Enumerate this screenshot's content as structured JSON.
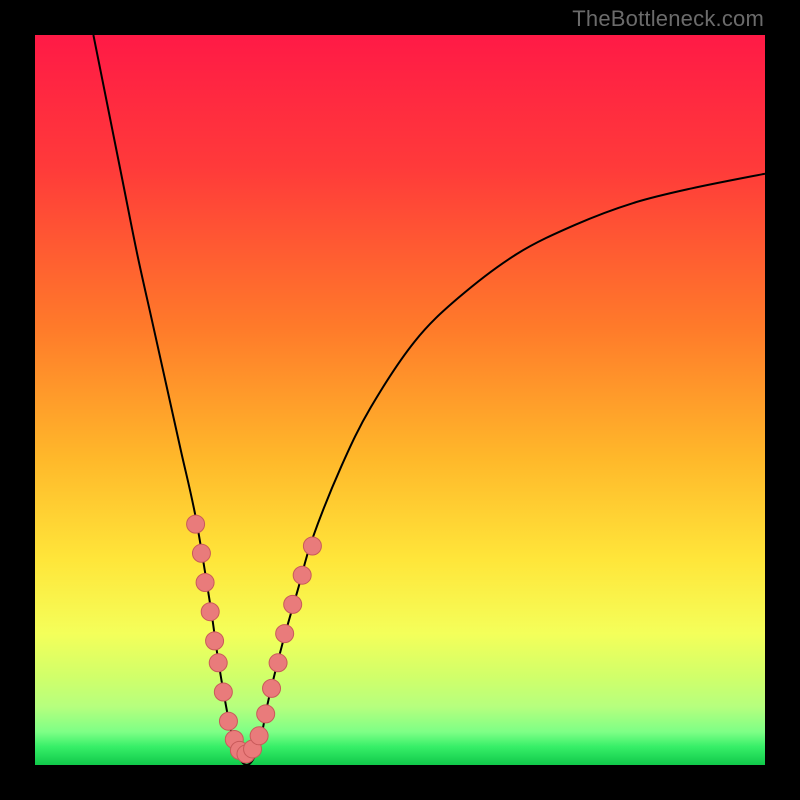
{
  "watermark": "TheBottleneck.com",
  "colors": {
    "black": "#000000",
    "curve": "#000000",
    "marker_fill": "#e97b7b",
    "marker_stroke": "#c95a5a",
    "gradient_stops": [
      {
        "offset": 0.0,
        "color": "#ff1a46"
      },
      {
        "offset": 0.18,
        "color": "#ff3a3a"
      },
      {
        "offset": 0.4,
        "color": "#ff7a2a"
      },
      {
        "offset": 0.58,
        "color": "#ffb82a"
      },
      {
        "offset": 0.72,
        "color": "#ffe63a"
      },
      {
        "offset": 0.82,
        "color": "#f4ff5a"
      },
      {
        "offset": 0.88,
        "color": "#d0ff6a"
      },
      {
        "offset": 0.92,
        "color": "#b6ff7e"
      },
      {
        "offset": 0.955,
        "color": "#7dff86"
      },
      {
        "offset": 0.975,
        "color": "#37ef68"
      },
      {
        "offset": 1.0,
        "color": "#10c94a"
      }
    ]
  },
  "chart_data": {
    "type": "line",
    "title": "",
    "xlabel": "",
    "ylabel": "",
    "xlim": [
      0,
      100
    ],
    "ylim": [
      0,
      100
    ],
    "grid": false,
    "legend": false,
    "series": [
      {
        "name": "bottleneck-curve",
        "x": [
          8,
          10,
          12,
          14,
          16,
          18,
          20,
          22,
          24,
          25,
          26,
          27,
          28,
          29,
          30,
          31,
          32,
          34,
          36,
          38,
          42,
          46,
          52,
          58,
          66,
          74,
          82,
          90,
          100
        ],
        "y": [
          100,
          90,
          80,
          70,
          61,
          52,
          43,
          34,
          22,
          15,
          9,
          4,
          1,
          0,
          1,
          4,
          9,
          17,
          24,
          31,
          41,
          49,
          58,
          64,
          70,
          74,
          77,
          79,
          81
        ]
      }
    ],
    "markers": [
      {
        "x": 22.0,
        "y": 33
      },
      {
        "x": 22.8,
        "y": 29
      },
      {
        "x": 23.3,
        "y": 25
      },
      {
        "x": 24.0,
        "y": 21
      },
      {
        "x": 24.6,
        "y": 17
      },
      {
        "x": 25.1,
        "y": 14
      },
      {
        "x": 25.8,
        "y": 10
      },
      {
        "x": 26.5,
        "y": 6
      },
      {
        "x": 27.3,
        "y": 3.5
      },
      {
        "x": 28.0,
        "y": 2.0
      },
      {
        "x": 28.9,
        "y": 1.5
      },
      {
        "x": 29.8,
        "y": 2.2
      },
      {
        "x": 30.7,
        "y": 4.0
      },
      {
        "x": 31.6,
        "y": 7.0
      },
      {
        "x": 32.4,
        "y": 10.5
      },
      {
        "x": 33.3,
        "y": 14
      },
      {
        "x": 34.2,
        "y": 18
      },
      {
        "x": 35.3,
        "y": 22
      },
      {
        "x": 36.6,
        "y": 26
      },
      {
        "x": 38.0,
        "y": 30
      }
    ]
  }
}
